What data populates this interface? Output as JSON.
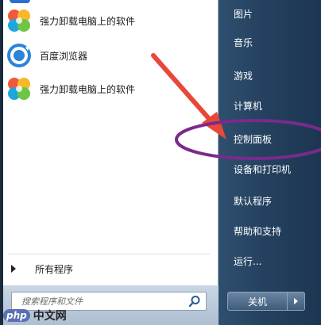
{
  "programs": [
    {
      "label": "强力卸载电脑上的软件",
      "icon": "petal-app-icon"
    },
    {
      "label": "百度浏览器",
      "icon": "baidu-browser-icon"
    },
    {
      "label": "强力卸载电脑上的软件",
      "icon": "petal-app-icon"
    }
  ],
  "all_programs_label": "所有程序",
  "search": {
    "placeholder": "搜索程序和文件"
  },
  "right_items": [
    {
      "label": "图片"
    },
    {
      "label": "音乐"
    },
    {
      "label": "游戏"
    },
    {
      "label": "计算机"
    },
    {
      "label": "控制面板"
    },
    {
      "label": "设备和打印机"
    },
    {
      "label": "默认程序"
    },
    {
      "label": "帮助和支持"
    },
    {
      "label": "运行..."
    }
  ],
  "shutdown_label": "关机",
  "watermark": {
    "php": "php",
    "site": "中文网"
  },
  "colors": {
    "annotation_arrow": "#e8473a",
    "annotation_ellipse": "#7a2a8c",
    "right_panel": "#24415f"
  }
}
